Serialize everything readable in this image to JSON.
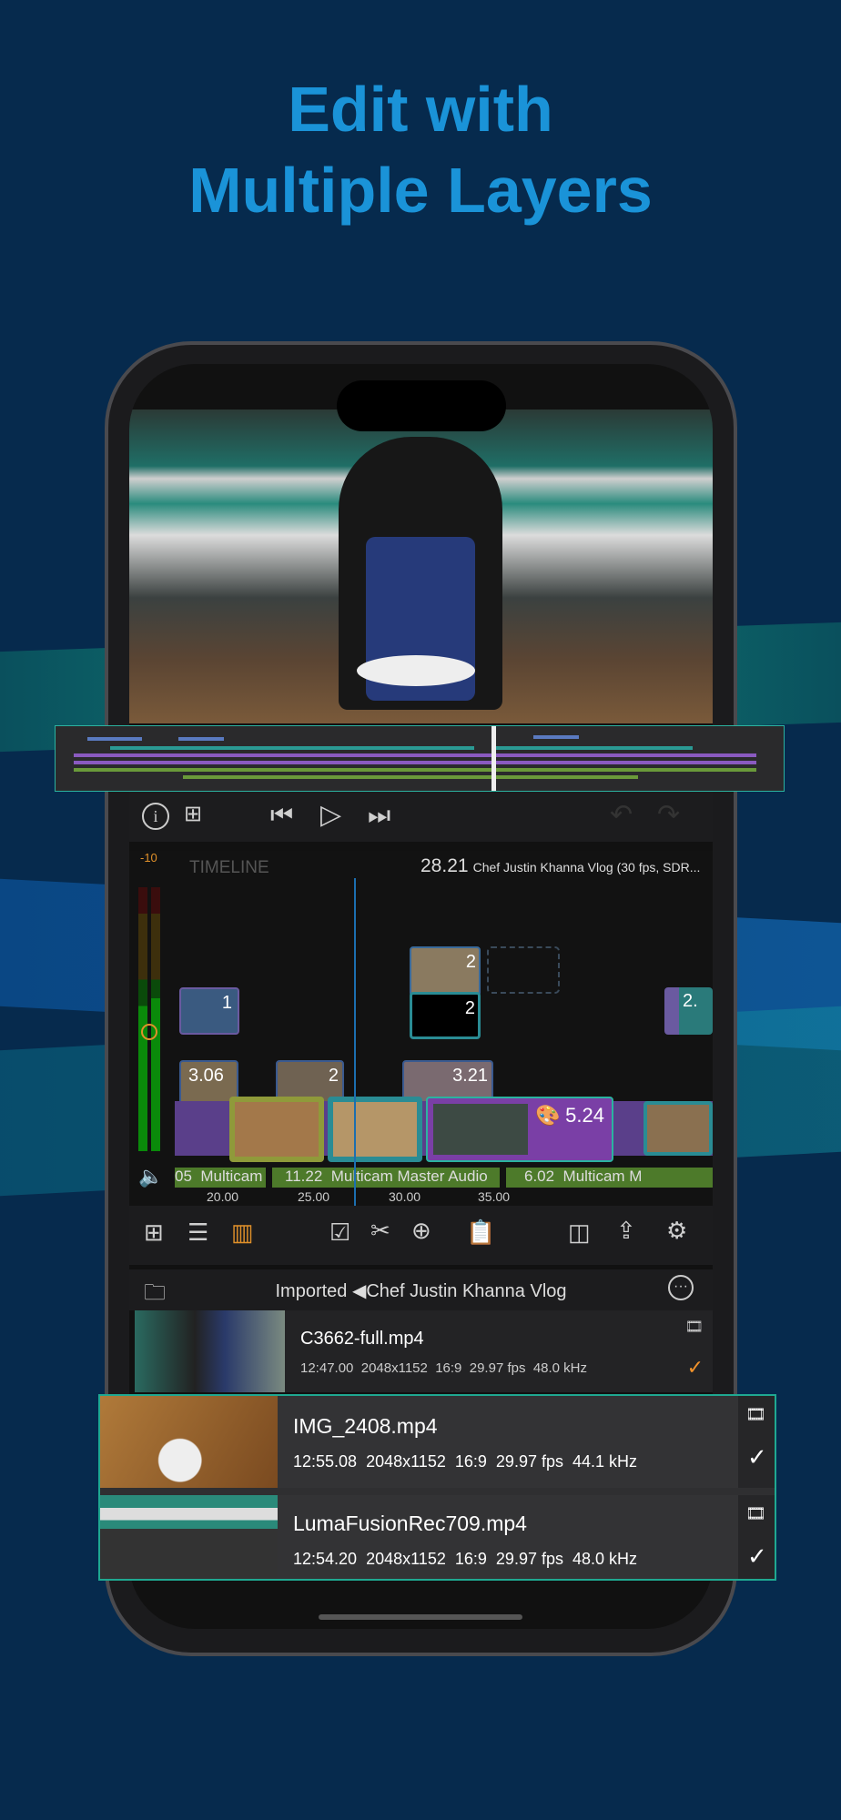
{
  "headline": {
    "line1": "Edit with",
    "line2": "Multiple Layers"
  },
  "colors": {
    "accent": "#1a93d8",
    "highlight": "#1fa891",
    "checkmark_orange": "#f0922b",
    "clip_purple": "#7a3fa6",
    "clip_teal": "#2a8c94",
    "clip_olive": "#8f9a3a",
    "audio_green": "#4d7a2a"
  },
  "transport": {
    "icons": [
      "info-icon",
      "add-marker-icon",
      "skip-back-icon",
      "play-icon",
      "skip-forward-icon",
      "undo-icon",
      "redo-icon"
    ]
  },
  "timeline": {
    "label": "TIMELINE",
    "playhead_time": "28.21",
    "project": "Chef Justin Khanna Vlog (30 fps, SDR...",
    "meter_label": "-10",
    "clips": [
      {
        "label": "1",
        "track": "title"
      },
      {
        "label": "3.06",
        "track": "b-roll"
      },
      {
        "label": "2",
        "track": "b-roll"
      },
      {
        "label": "2",
        "track": "overlay-top"
      },
      {
        "label": "2",
        "track": "overlay-mid"
      },
      {
        "label": "3.21",
        "track": "b-roll"
      },
      {
        "label": "5.24",
        "track": "main",
        "selected": true
      },
      {
        "label": "2.",
        "track": "title"
      }
    ],
    "audio": [
      {
        "duration": "05",
        "name": "Multicam"
      },
      {
        "duration": "11.22",
        "name": "Multicam Master Audio"
      },
      {
        "duration": "6.02",
        "name": "Multicam M"
      }
    ],
    "ruler": [
      "20.00",
      "25.00",
      "30.00",
      "35.00"
    ]
  },
  "toolbar": {
    "icons": [
      "add-track-icon",
      "list-icon",
      "waveform-icon",
      "select-icon",
      "scissors-icon",
      "add-icon",
      "paste-icon",
      "layout-icon",
      "share-icon",
      "settings-icon"
    ]
  },
  "library": {
    "path_folder": "Imported",
    "path_current": "Chef Justin Khanna Vlog",
    "items": [
      {
        "name": "C3662-full.mp4",
        "duration": "12:47.00",
        "resolution": "2048x1152",
        "aspect": "16:9",
        "fps": "29.97 fps",
        "audio": "48.0 kHz",
        "used": true
      },
      {
        "name": "IMG_2408.mp4",
        "duration": "12:55.08",
        "resolution": "2048x1152",
        "aspect": "16:9",
        "fps": "29.97 fps",
        "audio": "44.1 kHz",
        "used": true
      },
      {
        "name": "LumaFusionRec709.mp4",
        "duration": "12:54.20",
        "resolution": "2048x1152",
        "aspect": "16:9",
        "fps": "29.97 fps",
        "audio": "48.0 kHz",
        "used": true
      }
    ]
  }
}
